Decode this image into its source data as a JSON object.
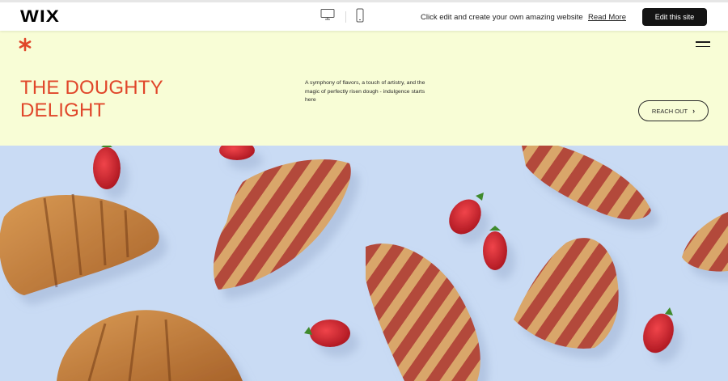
{
  "wixbar": {
    "logo": "WIX",
    "promo_text": "Click edit and create your own amazing website",
    "read_more": "Read More",
    "edit_button": "Edit this site"
  },
  "site": {
    "title_line1": "THE DOUGHTY",
    "title_line2": "DELIGHT",
    "description": "A symphony of flavors, a touch of artistry, and the magic of perfectly risen dough - indulgence starts here",
    "cta": "REACH OUT",
    "colors": {
      "accent": "#e0462a",
      "header_bg": "#f8fdd6",
      "photo_bg": "#c9dbf4"
    }
  }
}
